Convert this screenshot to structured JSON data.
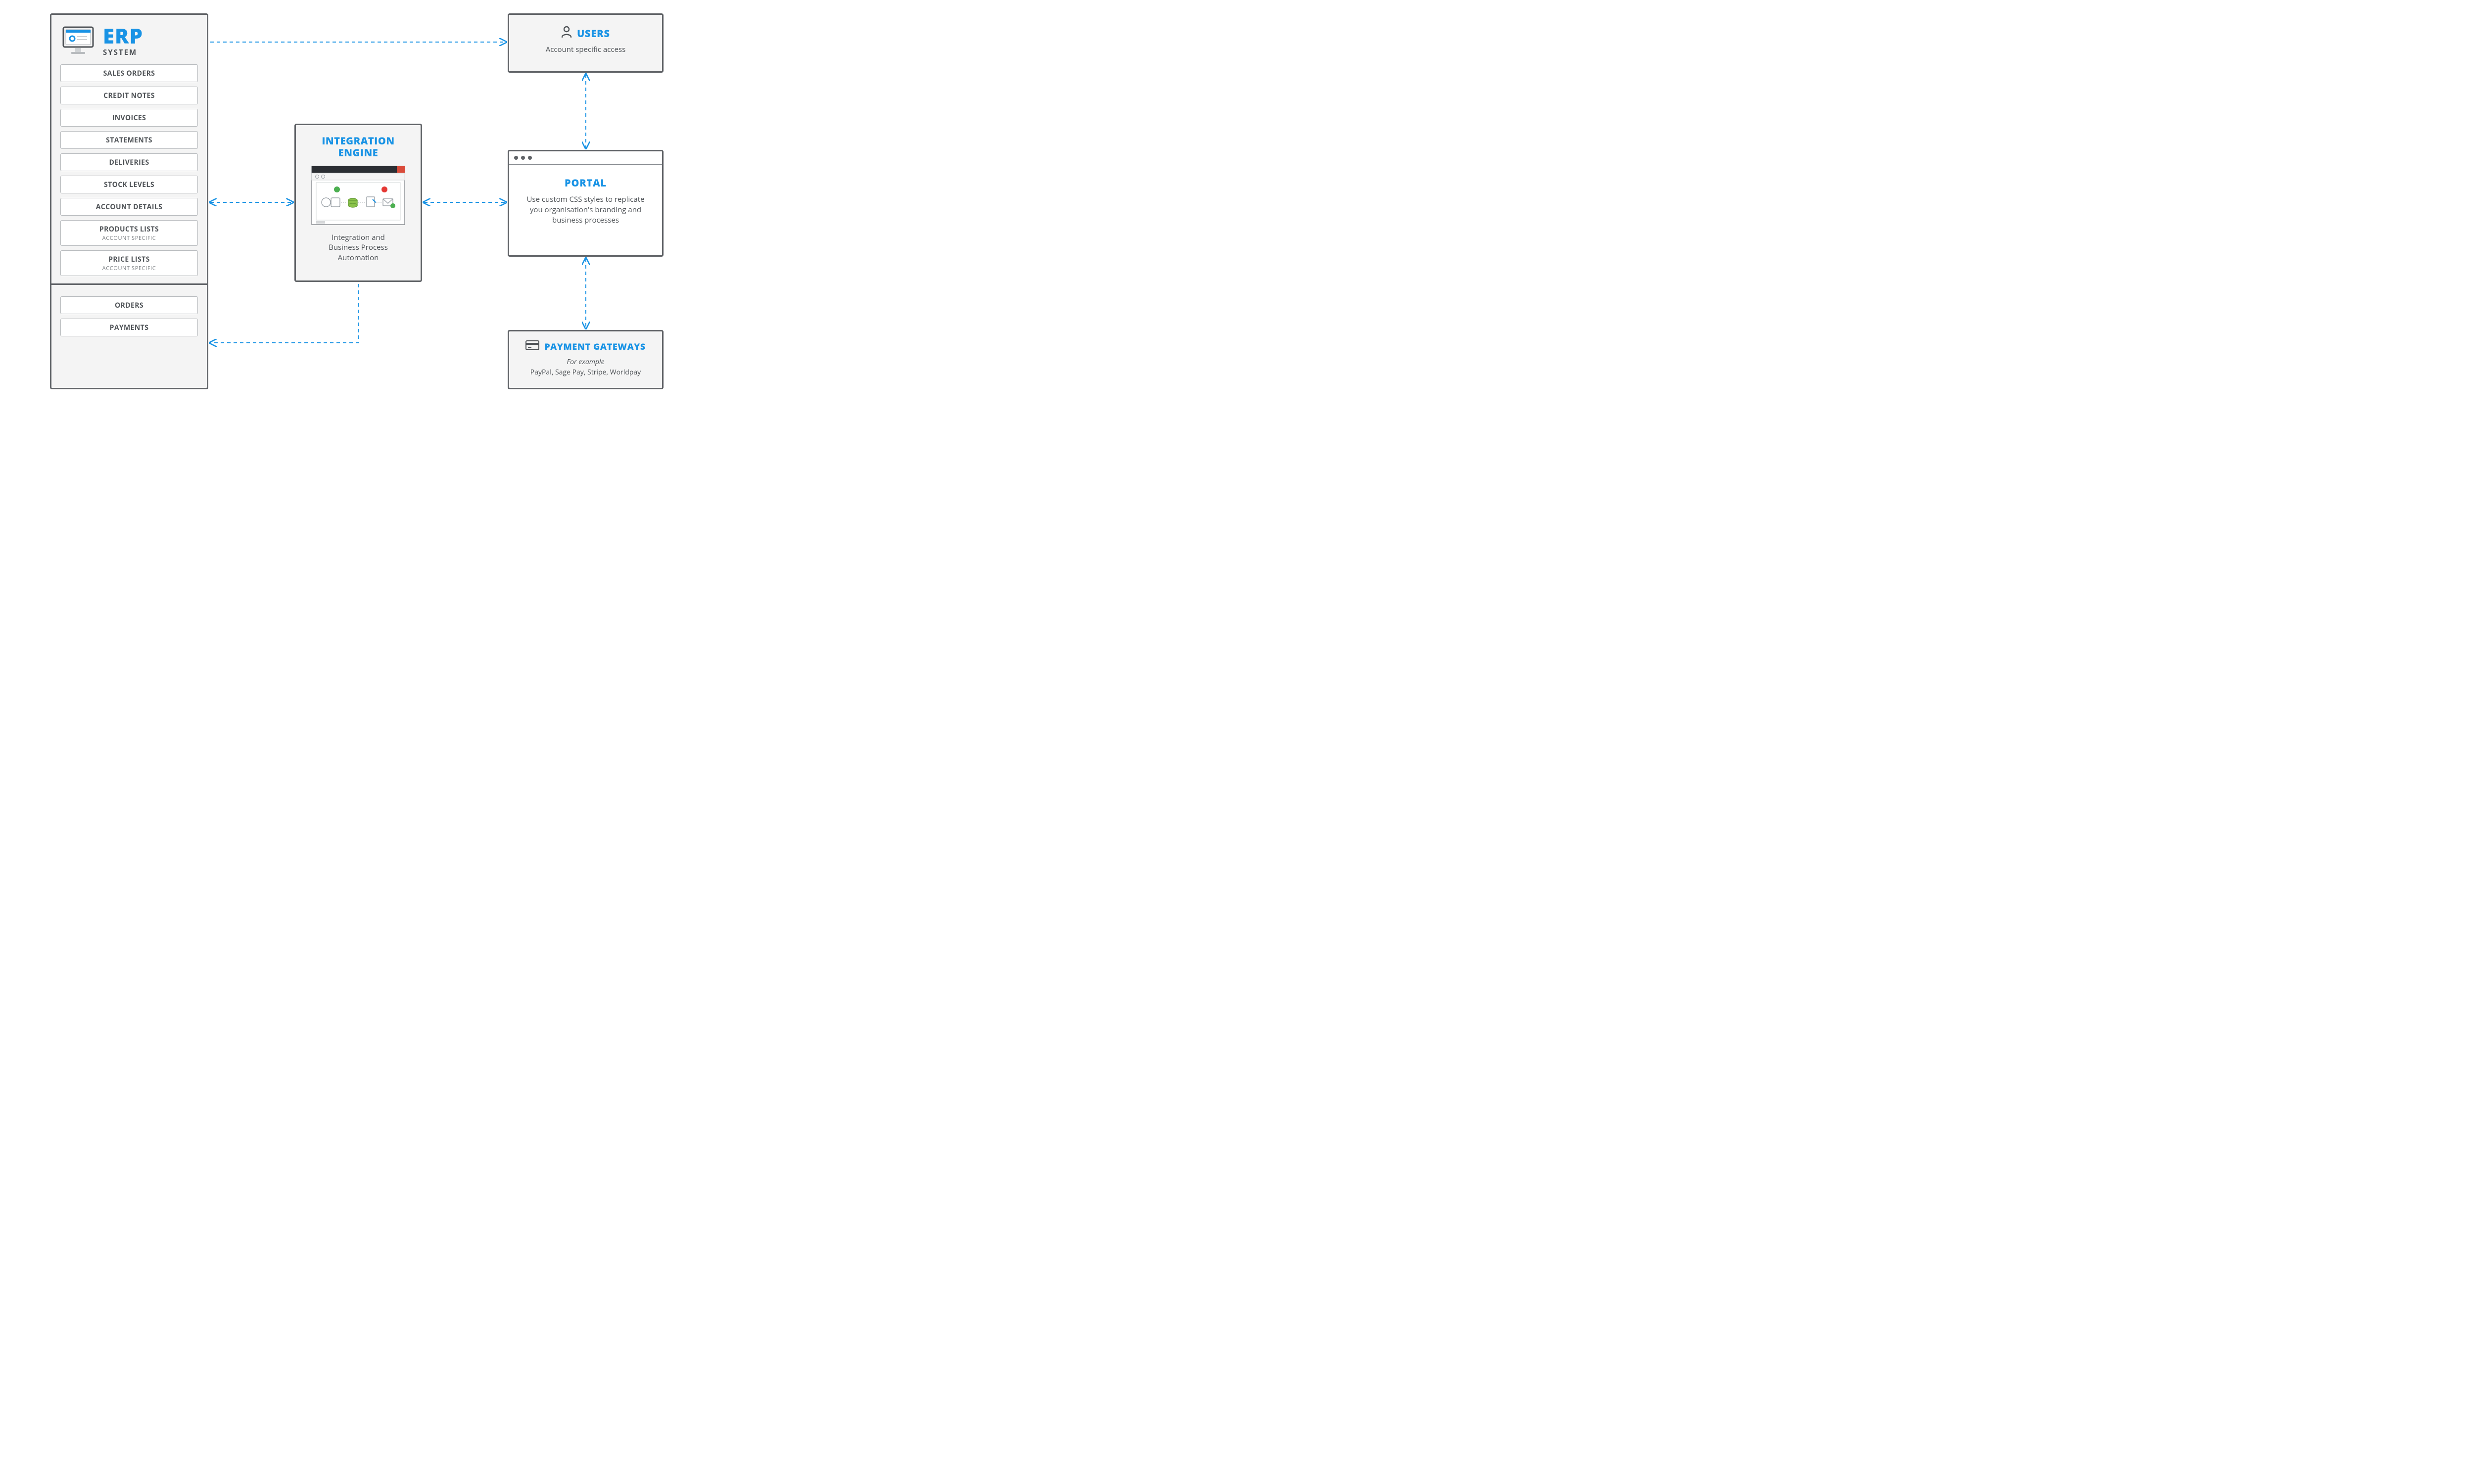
{
  "erp": {
    "title": "ERP",
    "subtitle": "SYSTEM",
    "upper_items": [
      {
        "label": "SALES ORDERS"
      },
      {
        "label": "CREDIT NOTES"
      },
      {
        "label": "INVOICES"
      },
      {
        "label": "STATEMENTS"
      },
      {
        "label": "DELIVERIES"
      },
      {
        "label": "STOCK LEVELS"
      },
      {
        "label": "ACCOUNT DETAILS"
      },
      {
        "label": "PRODUCTS LISTS",
        "sub": "ACCOUNT SPECIFIC"
      },
      {
        "label": "PRICE LISTS",
        "sub": "ACCOUNT SPECIFIC"
      }
    ],
    "lower_items": [
      {
        "label": "ORDERS"
      },
      {
        "label": "PAYMENTS"
      }
    ]
  },
  "engine": {
    "title_line1": "INTEGRATION",
    "title_line2": "ENGINE",
    "desc_line1": "Integration and",
    "desc_line2": "Business Process",
    "desc_line3": "Automation"
  },
  "users": {
    "title": "USERS",
    "desc": "Account specific access"
  },
  "portal": {
    "title": "PORTAL",
    "desc": "Use custom CSS styles to replicate you organisation's branding and business processes"
  },
  "gateways": {
    "title": "PAYMENT GATEWAYS",
    "example_label": "For example",
    "examples": "PayPal, Sage Pay, Stripe, Worldpay"
  }
}
